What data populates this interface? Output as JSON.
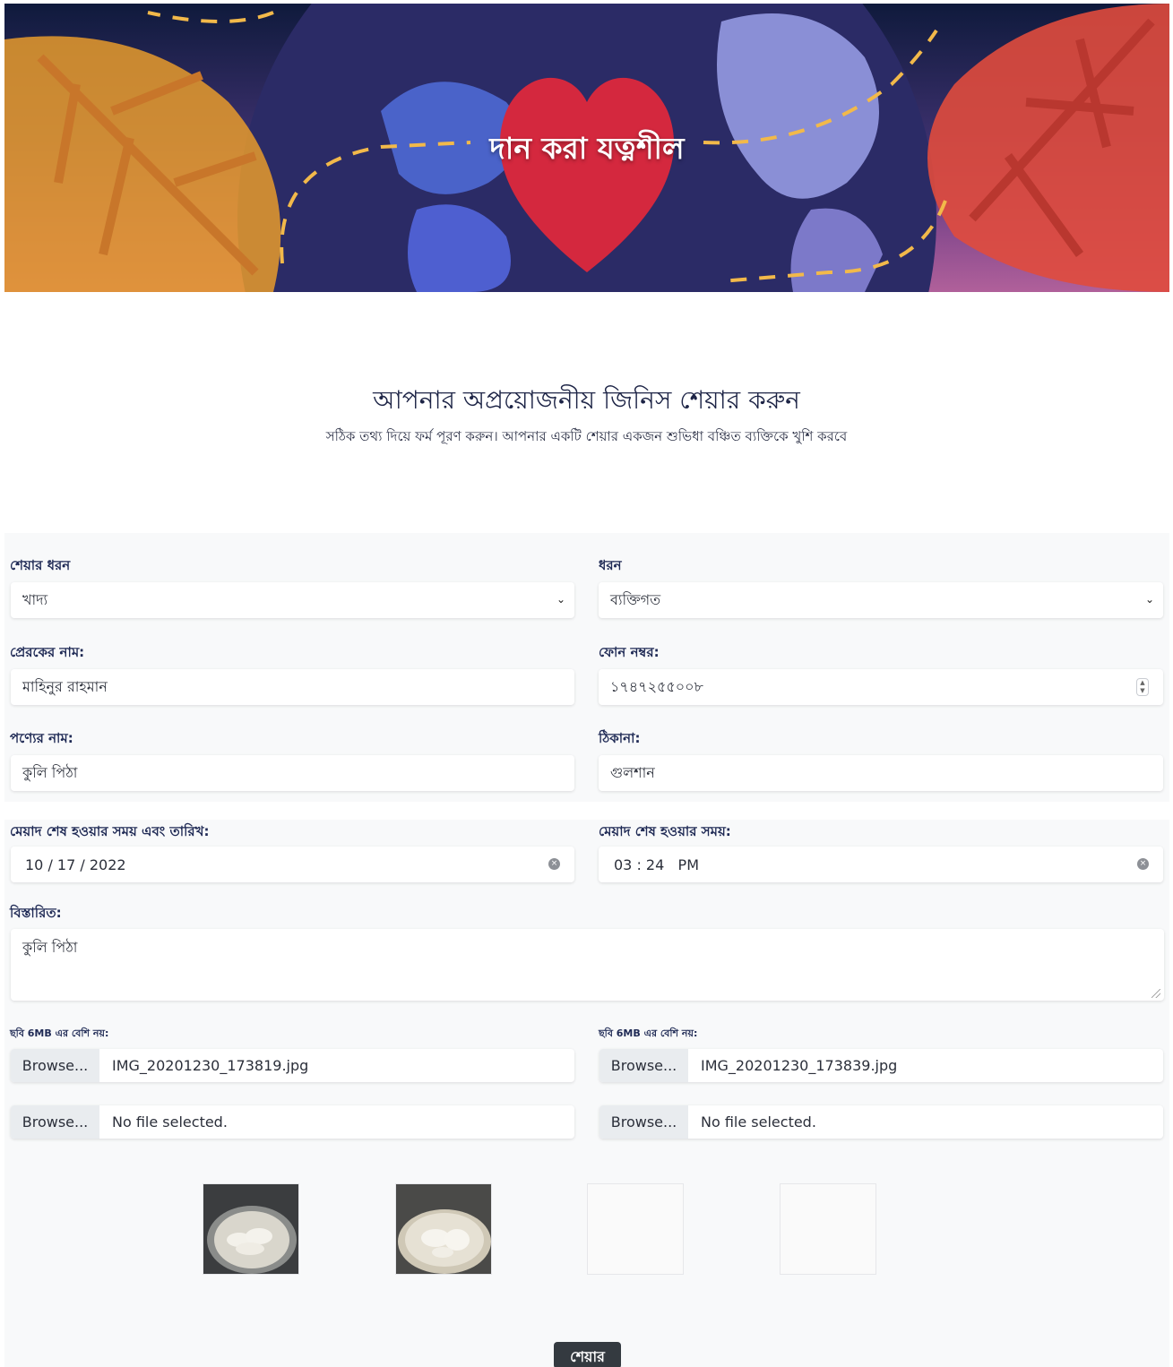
{
  "banner": {
    "title": "দান করা যত্নশীল"
  },
  "heading": {
    "title": "আপনার অপ্রয়োজনীয় জিনিস শেয়ার করুন",
    "subtitle": "সঠিক তথ্য দিয়ে ফর্ম পূরণ করুন। আপনার একটি শেয়ার একজন শুভিধা বঞ্চিত ব্যক্তিকে খুশি করবে"
  },
  "form": {
    "share_type": {
      "label": "শেয়ার ধরন",
      "value": "খাদ্য"
    },
    "type": {
      "label": "ধরন",
      "value": "ব্যক্তিগত"
    },
    "sender_name": {
      "label": "প্রেরকের নাম:",
      "value": "মাহিনুর রাহমান"
    },
    "phone": {
      "label": "ফোন নম্বর:",
      "value": "১৭৪৭২৫৫০০৮"
    },
    "product_name": {
      "label": "পণ্যের নাম:",
      "value": "কুলি পিঠা"
    },
    "address": {
      "label": "ঠিকানা:",
      "value": "গুলশান"
    },
    "expiry_date": {
      "label": "মেয়াদ শেষ হওয়ার সময় এবং তারিখ:",
      "value": "10 / 17 / 2022"
    },
    "expiry_time": {
      "label": "মেয়াদ শেষ হওয়ার সময়:",
      "value": "03 : 24   PM"
    },
    "details": {
      "label": "বিস্তারিত:",
      "value": "কুলি পিঠা"
    },
    "image_note_left": "ছবি 6MB এর বেশি নয়:",
    "image_note_right": "ছবি 6MB এর বেশি নয়:",
    "browse_label": "Browse...",
    "files": [
      "IMG_20201230_173819.jpg",
      "IMG_20201230_173839.jpg",
      "No file selected.",
      "No file selected."
    ],
    "submit_label": "শেয়ার"
  },
  "icons": {
    "select": "chevron-down-icon",
    "number": "spinner-icon",
    "clear": "clear-icon"
  }
}
